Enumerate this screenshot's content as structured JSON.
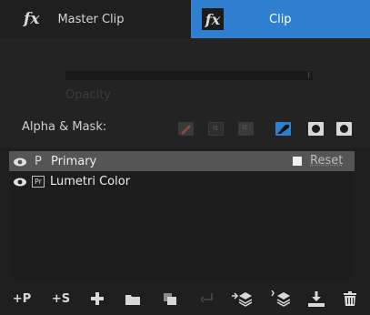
{
  "tabs": {
    "master": {
      "icon": "fx-icon",
      "label": "Master Clip"
    },
    "clip": {
      "icon": "fx-badge-icon",
      "label": "Clip",
      "active": true,
      "accent": "#2f7fd0"
    },
    "fx_glyph": "fx"
  },
  "params": {
    "opacity_label": "Opacity",
    "alpha_mask_label": "Alpha & Mask:",
    "mask_buttons": [
      {
        "icon": "pen-mask-icon",
        "enabled": false
      },
      {
        "icon": "alpha-icon",
        "enabled": false
      },
      {
        "icon": "alpha-inverse-icon",
        "enabled": false
      },
      {
        "icon": "pen-mask-active-icon",
        "enabled": true,
        "selected": true
      },
      {
        "icon": "circle-mask-icon",
        "enabled": true
      },
      {
        "icon": "circle-inverse-icon",
        "enabled": true
      }
    ]
  },
  "layers": [
    {
      "badge": "P",
      "name": "Primary",
      "visible": true,
      "selected": true,
      "reset_label": "Reset"
    },
    {
      "badge": "Pr",
      "name": "Lumetri Color",
      "visible": true,
      "selected": false
    }
  ],
  "toolbar": {
    "add_primary": "+P",
    "add_secondary": "+S",
    "buttons": [
      "add-icon",
      "folder-icon",
      "duplicate-icon",
      "return-icon",
      "import-layers-icon",
      "export-layers-icon",
      "download-icon",
      "trash-icon"
    ]
  },
  "colors": {
    "background": "#1f1f1f",
    "accent": "#2f7fd0",
    "selected_row": "#555555"
  }
}
